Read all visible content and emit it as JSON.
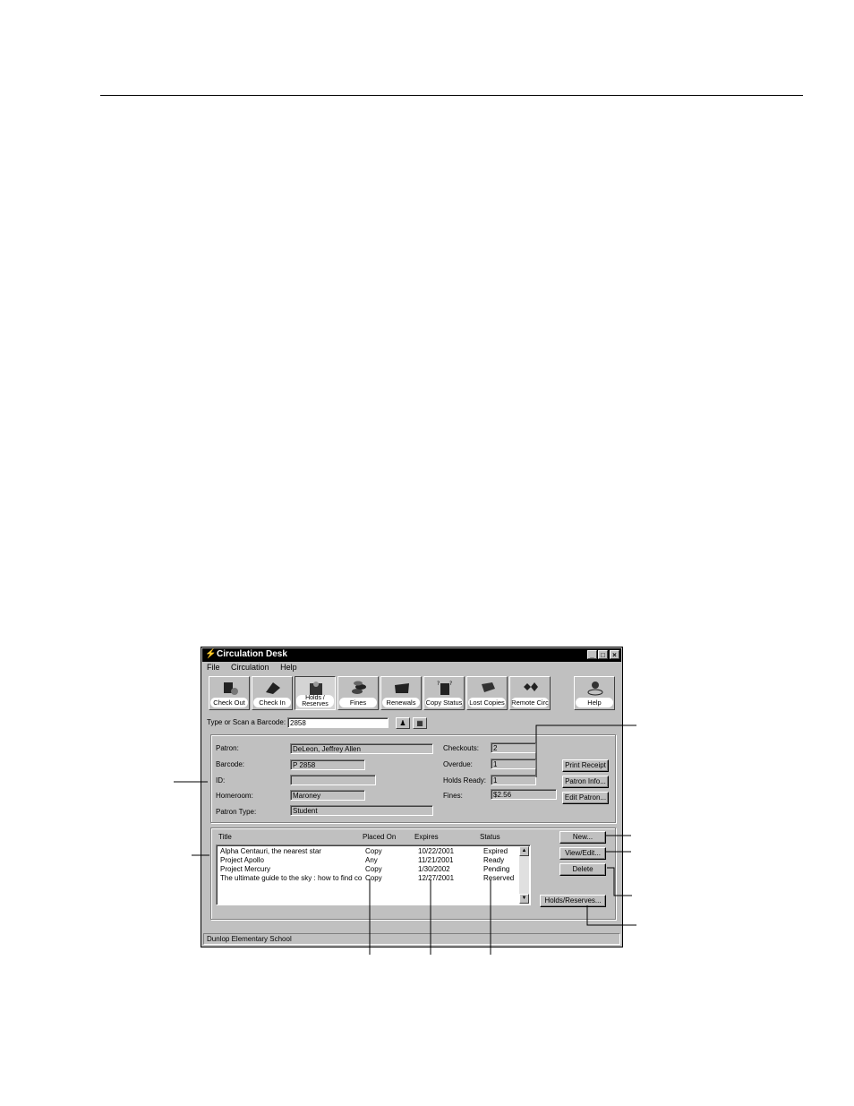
{
  "window": {
    "title": "Circulation Desk"
  },
  "menu": [
    "File",
    "Circulation",
    "Help"
  ],
  "toolbar": [
    {
      "label": "Check Out",
      "icon": "check-out-icon"
    },
    {
      "label": "Check In",
      "icon": "check-in-icon"
    },
    {
      "label": "Holds / Reserves",
      "icon": "holds-reserves-icon"
    },
    {
      "label": "Fines",
      "icon": "fines-icon"
    },
    {
      "label": "Renewals",
      "icon": "renewals-icon"
    },
    {
      "label": "Copy Status",
      "icon": "copy-status-icon"
    },
    {
      "label": "Lost Copies",
      "icon": "lost-copies-icon"
    },
    {
      "label": "Remote Circ",
      "icon": "remote-circ-icon"
    },
    {
      "label": "Help",
      "icon": "help-sos-icon"
    }
  ],
  "barcode": {
    "label": "Type or Scan a Barcode:",
    "value": "2858"
  },
  "patron": {
    "labels": {
      "patron": "Patron:",
      "barcode": "Barcode:",
      "id": "ID:",
      "homeroom": "Homeroom:",
      "patron_type": "Patron Type:",
      "checkouts": "Checkouts:",
      "overdue": "Overdue:",
      "holds_ready": "Holds Ready:",
      "fines": "Fines:"
    },
    "values": {
      "patron": "DeLeon, Jeffrey Allen",
      "barcode": "P 2858",
      "id": "",
      "homeroom": "Maroney",
      "patron_type": "Student",
      "checkouts": "2",
      "overdue": "1",
      "holds_ready": "1",
      "fines": "$2.56"
    },
    "buttons": {
      "print_receipt": "Print Receipt",
      "patron_info": "Patron Info...",
      "edit_patron": "Edit Patron..."
    }
  },
  "holds": {
    "columns": [
      "Title",
      "Placed On",
      "Expires",
      "Status"
    ],
    "rows": [
      {
        "title": "Alpha Centauri, the nearest star",
        "placed_on": "Copy",
        "expires": "10/22/2001",
        "status": "Expired"
      },
      {
        "title": "Project Apollo",
        "placed_on": "Any",
        "expires": "11/21/2001",
        "status": "Ready"
      },
      {
        "title": "Project Mercury",
        "placed_on": "Copy",
        "expires": "1/30/2002",
        "status": "Pending"
      },
      {
        "title": "The ultimate guide to the sky : how to find co",
        "placed_on": "Copy",
        "expires": "12/27/2001",
        "status": "Reserved"
      }
    ],
    "buttons": {
      "new": "New...",
      "view_edit": "View/Edit...",
      "delete": "Delete",
      "holds_reserves": "Holds/Reserves..."
    }
  },
  "statusbar": {
    "text": "Dunlop Elementary School"
  }
}
